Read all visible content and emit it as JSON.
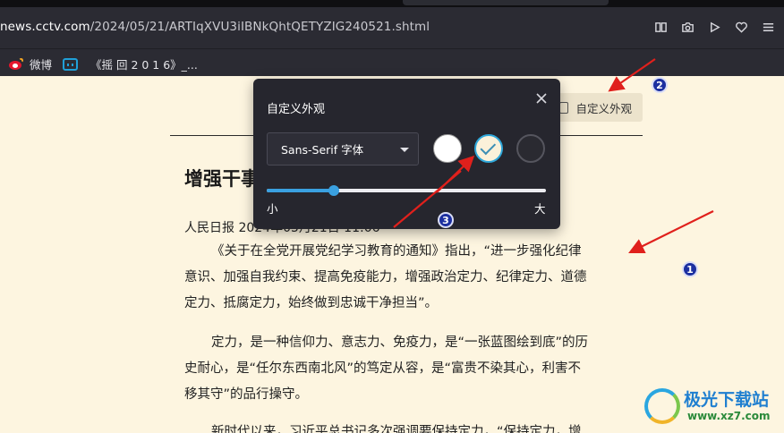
{
  "browser": {
    "url_host": "news.cctv.com",
    "url_path": "/2024/05/21/ARTIqXVU3iIBNkQhtQETYZIG240521.shtml",
    "toolbar_icons": [
      "reader-icon",
      "camera-icon",
      "play-icon",
      "heart-icon",
      "menu-icon"
    ]
  },
  "bookmarks": [
    {
      "label": "微博",
      "icon": "weibo-icon"
    },
    {
      "label": "《摇 回 2 0 1 6》_...",
      "icon": "bilibili-icon"
    }
  ],
  "page": {
    "custom_appearance_button": "自定义外观",
    "title_partial": "增强干事",
    "byline": "人民日报 2024年05月21日 11:06",
    "paragraphs": [
      [
        "《关于在全党开展党纪学习教育的通知》指出，“进一步强化纪律",
        "意识、加强自我约束、提高免疫能力，增强政治定力、纪律定力、道德",
        "定力、抵腐定力，始终做到忠诚干净担当”。"
      ],
      [
        "定力，是一种信仰力、意志力、免疫力，是“一张蓝图绘到底”的历",
        "史耐心，是“任尔东西南北风”的笃定从容，是“富贵不染其心，利害不",
        "移其守”的品行操守。"
      ],
      [
        "新时代以来，习近平总书记多次强调要保持定力，“保持定力，增"
      ]
    ]
  },
  "popup": {
    "title": "自定义外观",
    "font_select_value": "Sans-Serif 字体",
    "themes": [
      {
        "name": "white",
        "color": "#ffffff",
        "selected": false
      },
      {
        "name": "sepia",
        "color": "#fbf1da",
        "selected": true
      },
      {
        "name": "dark",
        "color": "#2a2a31",
        "selected": false
      }
    ],
    "font_size_level": 0.24,
    "size_min_label": "小",
    "size_max_label": "大"
  },
  "annotations": {
    "badges": [
      "1",
      "2",
      "3"
    ],
    "arrow_color": "#e0201c"
  },
  "watermark": {
    "title": "极光下载站",
    "url": "www.xz7.com"
  },
  "colors": {
    "accent": "#3aa0e0",
    "page_bg": "#fdf5e0",
    "popup_bg": "#26262e"
  }
}
